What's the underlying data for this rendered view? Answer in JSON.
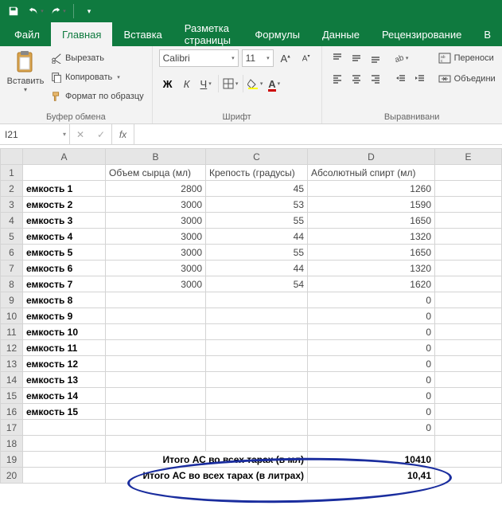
{
  "qat": {
    "save": "save",
    "undo": "undo",
    "redo": "redo"
  },
  "tabs": {
    "file": "Файл",
    "home": "Главная",
    "insert": "Вставка",
    "page_layout": "Разметка страницы",
    "formulas": "Формулы",
    "data": "Данные",
    "review": "Рецензирование",
    "view_partial": "В"
  },
  "clipboard": {
    "paste": "Вставить",
    "cut": "Вырезать",
    "copy": "Копировать",
    "format_painter": "Формат по образцу",
    "group_label": "Буфер обмена"
  },
  "font": {
    "name": "Calibri",
    "size": "11",
    "bold": "Ж",
    "italic": "К",
    "underline": "Ч",
    "group_label": "Шрифт"
  },
  "alignment": {
    "wrap_text": "Переноси",
    "merge": "Объедини",
    "group_label": "Выравнивани"
  },
  "name_box": "I21",
  "fx": "fx",
  "columns": {
    "A": "A",
    "B": "B",
    "C": "C",
    "D": "D",
    "E": "E"
  },
  "headers": {
    "volume": "Объем сырца (мл)",
    "strength": "Крепость (градусы)",
    "abs_alcohol": "Абсолютный спирт (мл)"
  },
  "rows": [
    {
      "n": 1,
      "label": "",
      "vol": "",
      "str": "",
      "abs": ""
    },
    {
      "n": 2,
      "label": "емкость 1",
      "vol": "2800",
      "str": "45",
      "abs": "1260"
    },
    {
      "n": 3,
      "label": "емкость 2",
      "vol": "3000",
      "str": "53",
      "abs": "1590"
    },
    {
      "n": 4,
      "label": "емкость 3",
      "vol": "3000",
      "str": "55",
      "abs": "1650"
    },
    {
      "n": 5,
      "label": "емкость 4",
      "vol": "3000",
      "str": "44",
      "abs": "1320"
    },
    {
      "n": 6,
      "label": "емкость 5",
      "vol": "3000",
      "str": "55",
      "abs": "1650"
    },
    {
      "n": 7,
      "label": "емкость 6",
      "vol": "3000",
      "str": "44",
      "abs": "1320"
    },
    {
      "n": 8,
      "label": "емкость 7",
      "vol": "3000",
      "str": "54",
      "abs": "1620"
    },
    {
      "n": 9,
      "label": "емкость 8",
      "vol": "",
      "str": "",
      "abs": "0"
    },
    {
      "n": 10,
      "label": "емкость 9",
      "vol": "",
      "str": "",
      "abs": "0"
    },
    {
      "n": 11,
      "label": "емкость 10",
      "vol": "",
      "str": "",
      "abs": "0"
    },
    {
      "n": 12,
      "label": "емкость 11",
      "vol": "",
      "str": "",
      "abs": "0"
    },
    {
      "n": 13,
      "label": "емкость 12",
      "vol": "",
      "str": "",
      "abs": "0"
    },
    {
      "n": 14,
      "label": "емкость 13",
      "vol": "",
      "str": "",
      "abs": "0"
    },
    {
      "n": 15,
      "label": "емкость 14",
      "vol": "",
      "str": "",
      "abs": "0"
    },
    {
      "n": 16,
      "label": "емкость 15",
      "vol": "",
      "str": "",
      "abs": "0"
    },
    {
      "n": 17,
      "label": "",
      "vol": "",
      "str": "",
      "abs": "0"
    },
    {
      "n": 18,
      "label": "",
      "vol": "",
      "str": "",
      "abs": ""
    }
  ],
  "totals": {
    "ml_label": "Итого АС во всех тарах  (в мл)",
    "ml_value": "10410",
    "l_label": "Итого АС во всех тарах  (в литрах)",
    "l_value": "10,41",
    "row_ml": 19,
    "row_l": 20
  }
}
